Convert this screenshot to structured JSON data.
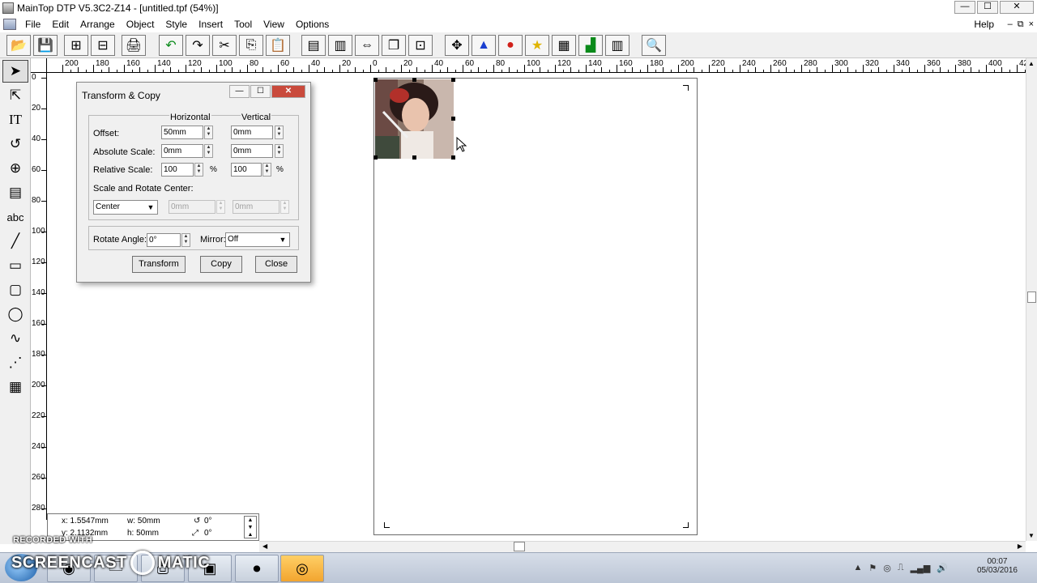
{
  "window": {
    "title": "MainTop DTP V5.3C2-Z14 - [untitled.tpf (54%)]",
    "min_glyph": "—",
    "max_glyph": "☐",
    "close_glyph": "✕"
  },
  "menu": {
    "items": [
      "File",
      "Edit",
      "Arrange",
      "Object",
      "Style",
      "Insert",
      "Tool",
      "View",
      "Options"
    ],
    "help": "Help",
    "mdi_buttons": [
      "–",
      "⧉",
      "×"
    ]
  },
  "toolbar": {
    "icons": [
      "open-icon",
      "save-icon",
      "import-icon",
      "export-icon",
      "print-icon",
      "undo-icon",
      "redo-icon",
      "cut-icon",
      "copy-icon",
      "paste-icon",
      "align-left-icon",
      "align-right-icon",
      "distribute-icon",
      "group-icon",
      "ungroup-icon",
      "move-icon",
      "color-shapes-icon",
      "color-palette-icon",
      "star-icon",
      "map-icon",
      "chart-icon",
      "text-frame-icon",
      "find-icon"
    ],
    "glyphs": [
      "📂",
      "💾",
      "⊞",
      "⊟",
      "🖨",
      "↶",
      "↷",
      "✂",
      "⎘",
      "📋",
      "▤",
      "▥",
      "⇔",
      "❐",
      "⊡",
      "✥",
      "▲",
      "●",
      "★",
      "▦",
      "▟",
      "▥",
      "🔍"
    ]
  },
  "tools": {
    "icons": [
      "pointer-icon",
      "node-select-icon",
      "text-tool-icon",
      "rotate-icon",
      "zoom-icon",
      "frame-icon",
      "abc-text-icon",
      "line-icon",
      "rectangle-icon",
      "rounded-rect-icon",
      "ellipse-icon",
      "curve-icon",
      "dotted-line-icon",
      "table-icon"
    ],
    "glyphs": [
      "➤",
      "⇱",
      "IT",
      "↺",
      "⊕",
      "▤",
      "abc",
      "╱",
      "▭",
      "▢",
      "◯",
      "∿",
      "⋰",
      "▦"
    ]
  },
  "ruler_h": {
    "labels": [
      "200",
      "180",
      "160",
      "140",
      "120",
      "100",
      "80",
      "60",
      "40",
      "20",
      "0",
      "20",
      "40",
      "60",
      "80",
      "100",
      "120",
      "140",
      "160",
      "180",
      "200",
      "220",
      "240",
      "260",
      "280",
      "300",
      "320",
      "340",
      "360",
      "380",
      "400",
      "42"
    ]
  },
  "ruler_v": {
    "labels": [
      "0",
      "20",
      "40",
      "60",
      "80",
      "100",
      "120",
      "140",
      "160",
      "180",
      "200",
      "220",
      "240",
      "260",
      "280"
    ]
  },
  "dialog": {
    "title": "Transform & Copy",
    "col_horizontal": "Horizontal",
    "col_vertical": "Vertical",
    "offset_label": "Offset:",
    "offset_h": "50mm",
    "offset_v": "0mm",
    "abs_scale_label": "Absolute Scale:",
    "abs_scale_h": "0mm",
    "abs_scale_v": "0mm",
    "rel_scale_label": "Relative Scale:",
    "rel_scale_h": "100",
    "rel_scale_v": "100",
    "percent": "%",
    "center_label": "Scale and Rotate Center:",
    "center_value": "Center",
    "center_h": "0mm",
    "center_v": "0mm",
    "rotate_label": "Rotate Angle:",
    "rotate_value": "0°",
    "mirror_label": "Mirror:",
    "mirror_value": "Off",
    "btn_transform": "Transform",
    "btn_copy": "Copy",
    "btn_close": "Close"
  },
  "status": {
    "x": "x: 1.5547mm",
    "y": "y: 2.1132mm",
    "w": "w: 50mm",
    "h": "h: 50mm",
    "rot": "0°",
    "skew": "0°"
  },
  "taskbar": {
    "time": "00:07",
    "date": "05/03/2016"
  },
  "watermark": {
    "small": "RECORDED WITH",
    "left": "SCREENCAST",
    "right": "MATIC"
  }
}
